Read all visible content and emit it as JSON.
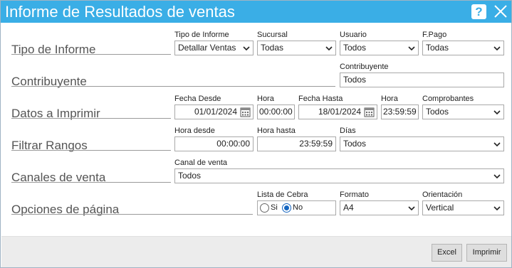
{
  "window": {
    "title": "Informe de Resultados de ventas",
    "help_label": "?"
  },
  "sections": {
    "tipo_informe": "Tipo de Informe",
    "contribuyente": "Contribuyente",
    "datos_imprimir": "Datos a Imprimir",
    "filtrar_rangos": "Filtrar Rangos",
    "canales_venta": "Canales de venta",
    "opciones_pagina": "Opciones de página"
  },
  "tipo_informe_row": {
    "tipo_label": "Tipo de Informe",
    "tipo_value": "Detallar Ventas",
    "sucursal_label": "Sucursal",
    "sucursal_value": "Todas",
    "usuario_label": "Usuario",
    "usuario_value": "Todos",
    "fpago_label": "F.Pago",
    "fpago_value": "Todas"
  },
  "contribuyente_row": {
    "label": "Contribuyente",
    "value": "Todos"
  },
  "datos_row": {
    "fecha_desde_label": "Fecha Desde",
    "fecha_desde_value": "01/01/2024",
    "hora_desde_label": "Hora",
    "hora_desde_value": "00:00:00",
    "fecha_hasta_label": "Fecha Hasta",
    "fecha_hasta_value": "18/01/2024",
    "hora_hasta_label": "Hora",
    "hora_hasta_value": "23:59:59",
    "comprobantes_label": "Comprobantes",
    "comprobantes_value": "Todos"
  },
  "rangos_row": {
    "hora_desde_label": "Hora desde",
    "hora_desde_value": "00:00:00",
    "hora_hasta_label": "Hora hasta",
    "hora_hasta_value": "23:59:59",
    "dias_label": "Días",
    "dias_value": "Todos"
  },
  "canales_row": {
    "label": "Canal de venta",
    "value": "Todos"
  },
  "opciones_row": {
    "cebra_label": "Lista de Cebra",
    "cebra_si": "Si",
    "cebra_no": "No",
    "cebra_selected": "No",
    "formato_label": "Formato",
    "formato_value": "A4",
    "orientacion_label": "Orientación",
    "orientacion_value": "Vertical"
  },
  "footer": {
    "excel_label": "Excel",
    "imprimir_label": "Imprimir"
  },
  "colors": {
    "titlebar": "#3aaee6",
    "radio_selected": "#1565c0",
    "footer_bg": "#ececec"
  }
}
